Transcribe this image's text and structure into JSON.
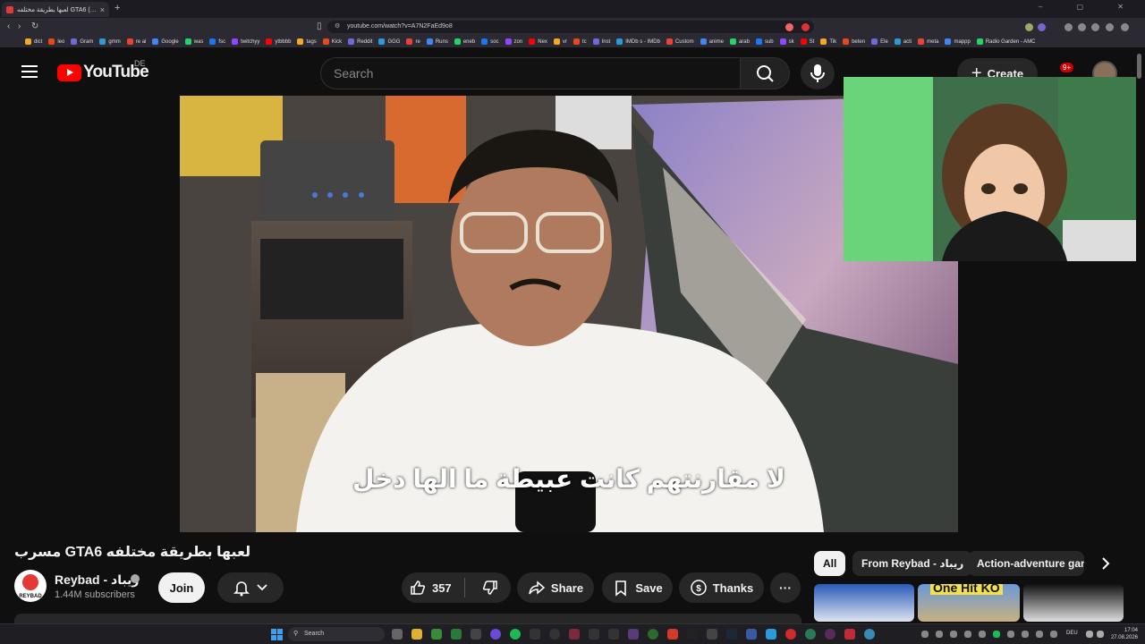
{
  "browser": {
    "tab_title": "لعبها بطريقة مختلفه GTA6 مسرب (9)",
    "tab_close": "×",
    "new_tab": "+",
    "url": "youtube.com/watch?v=A7N2FaEd9o8",
    "bookmarks": [
      "dict",
      "leo",
      "Gram",
      "gmm",
      "re ai",
      "Google",
      "was",
      "fsc",
      "twitchyy",
      "ytbbbb",
      "tags",
      "Kick",
      "Reddit",
      "GGG",
      "re",
      "Runs",
      "eneb",
      "soc",
      "zon",
      "Nex",
      "vr",
      "tc",
      "Inst",
      "IMDb s - IMDb",
      "Custom",
      "anime",
      "arab",
      "sub",
      "sk",
      "St",
      "Tik",
      "beten",
      "Ele",
      "acti",
      "meta",
      "mappp",
      "Radio Garden - AMC"
    ]
  },
  "header": {
    "logo_text": "YouTube",
    "country_code": "DE",
    "search_placeholder": "Search",
    "create_label": "Create",
    "notifications_count": "9+"
  },
  "video": {
    "subtitle": "لا مقارنتهم كانت عبيطة ما الها دخل",
    "title": "لعبها بطريقة مختلفه GTA6 مسرب"
  },
  "channel": {
    "name": "Reybad - ريباد",
    "subscribers": "1.44M subscribers",
    "avatar_text": "REYBAD",
    "join_label": "Join"
  },
  "actions": {
    "likes": "357",
    "share_label": "Share",
    "save_label": "Save",
    "thanks_label": "Thanks",
    "more_label": "···"
  },
  "chips": [
    {
      "label": "All",
      "selected": true
    },
    {
      "label": "From Reybad - ريباد",
      "selected": false
    },
    {
      "label": "Action-adventure gan",
      "selected": false
    }
  ],
  "recommended_thumbnail_text": "One Hit KO",
  "taskbar": {
    "search_label": "Search",
    "language": "DEU",
    "time": "17:04",
    "date": "27.08.2026"
  }
}
